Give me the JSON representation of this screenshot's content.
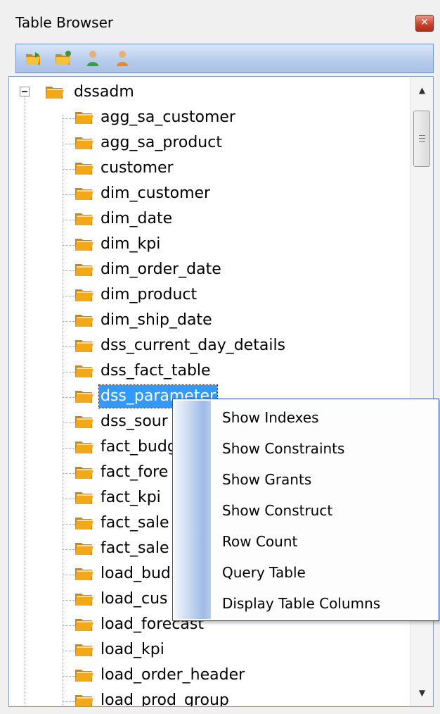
{
  "window": {
    "title": "Table Browser"
  },
  "toolbar": {
    "icons": [
      "open-folder-icon",
      "folder-icon",
      "user-green-icon",
      "user-orange-icon"
    ]
  },
  "tree": {
    "root": "dssadm",
    "items": [
      "agg_sa_customer",
      "agg_sa_product",
      "customer",
      "dim_customer",
      "dim_date",
      "dim_kpi",
      "dim_order_date",
      "dim_product",
      "dim_ship_date",
      "dss_current_day_details",
      "dss_fact_table",
      "dss_parameter",
      "dss_sour",
      "fact_budg",
      "fact_fore",
      "fact_kpi",
      "fact_sale",
      "fact_sale",
      "load_bud",
      "load_cus",
      "load_forecast",
      "load_kpi",
      "load_order_header",
      "load_prod_group"
    ],
    "selected_index": 11
  },
  "context_menu": {
    "items": [
      "Show Indexes",
      "Show Constraints",
      "Show Grants",
      "Show Construct",
      "Row Count",
      "Query Table",
      "Display Table Columns"
    ]
  },
  "colors": {
    "selection": "#3399ff",
    "folder": "#f2a818",
    "menu_border": "#2a56a8"
  }
}
